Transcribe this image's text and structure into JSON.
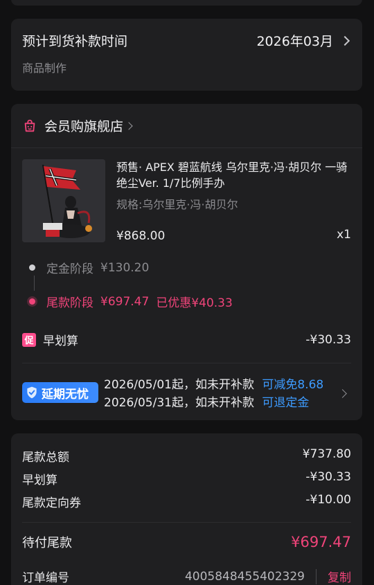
{
  "delivery": {
    "title": "预计到货补款时间",
    "value": "2026年03月",
    "subtitle": "商品制作"
  },
  "shop": {
    "name": "会员购旗舰店",
    "icon": "shopping-bag-icon"
  },
  "product": {
    "title": "预售· APEX 碧蓝航线 乌尔里克·冯·胡贝尔 一骑绝尘Ver. 1/7比例手办",
    "spec": "规格:乌尔里克·冯·胡贝尔",
    "price": "¥868.00",
    "quantity": "x1"
  },
  "stages": {
    "deposit": {
      "label": "定金阶段",
      "amount": "¥130.20"
    },
    "final": {
      "label": "尾款阶段",
      "amount": "¥697.47",
      "discount": "已优惠¥40.33"
    }
  },
  "promo": {
    "badge": "促",
    "name": "早划算",
    "value": "-¥30.33"
  },
  "delay": {
    "badge": "延期无忧",
    "line1": "2026/05/01起，如未开补款",
    "line1_benefit": "可减免8.68",
    "line2": "2026/05/31起，如未开补款",
    "line2_benefit": "可退定金"
  },
  "summary": {
    "rows": [
      {
        "label": "尾款总额",
        "value": "¥737.80"
      },
      {
        "label": "早划算",
        "value": "-¥30.33"
      },
      {
        "label": "尾款定向券",
        "value": "-¥10.00"
      }
    ],
    "due_label": "待付尾款",
    "due_value": "¥697.47",
    "order_label": "订单编号",
    "order_number": "4005848455402329",
    "copy_label": "复制"
  },
  "colors": {
    "accent_pink": "#f0447a",
    "accent_blue": "#3d9bff",
    "card_bg": "#1f1f21",
    "page_bg": "#111112"
  }
}
